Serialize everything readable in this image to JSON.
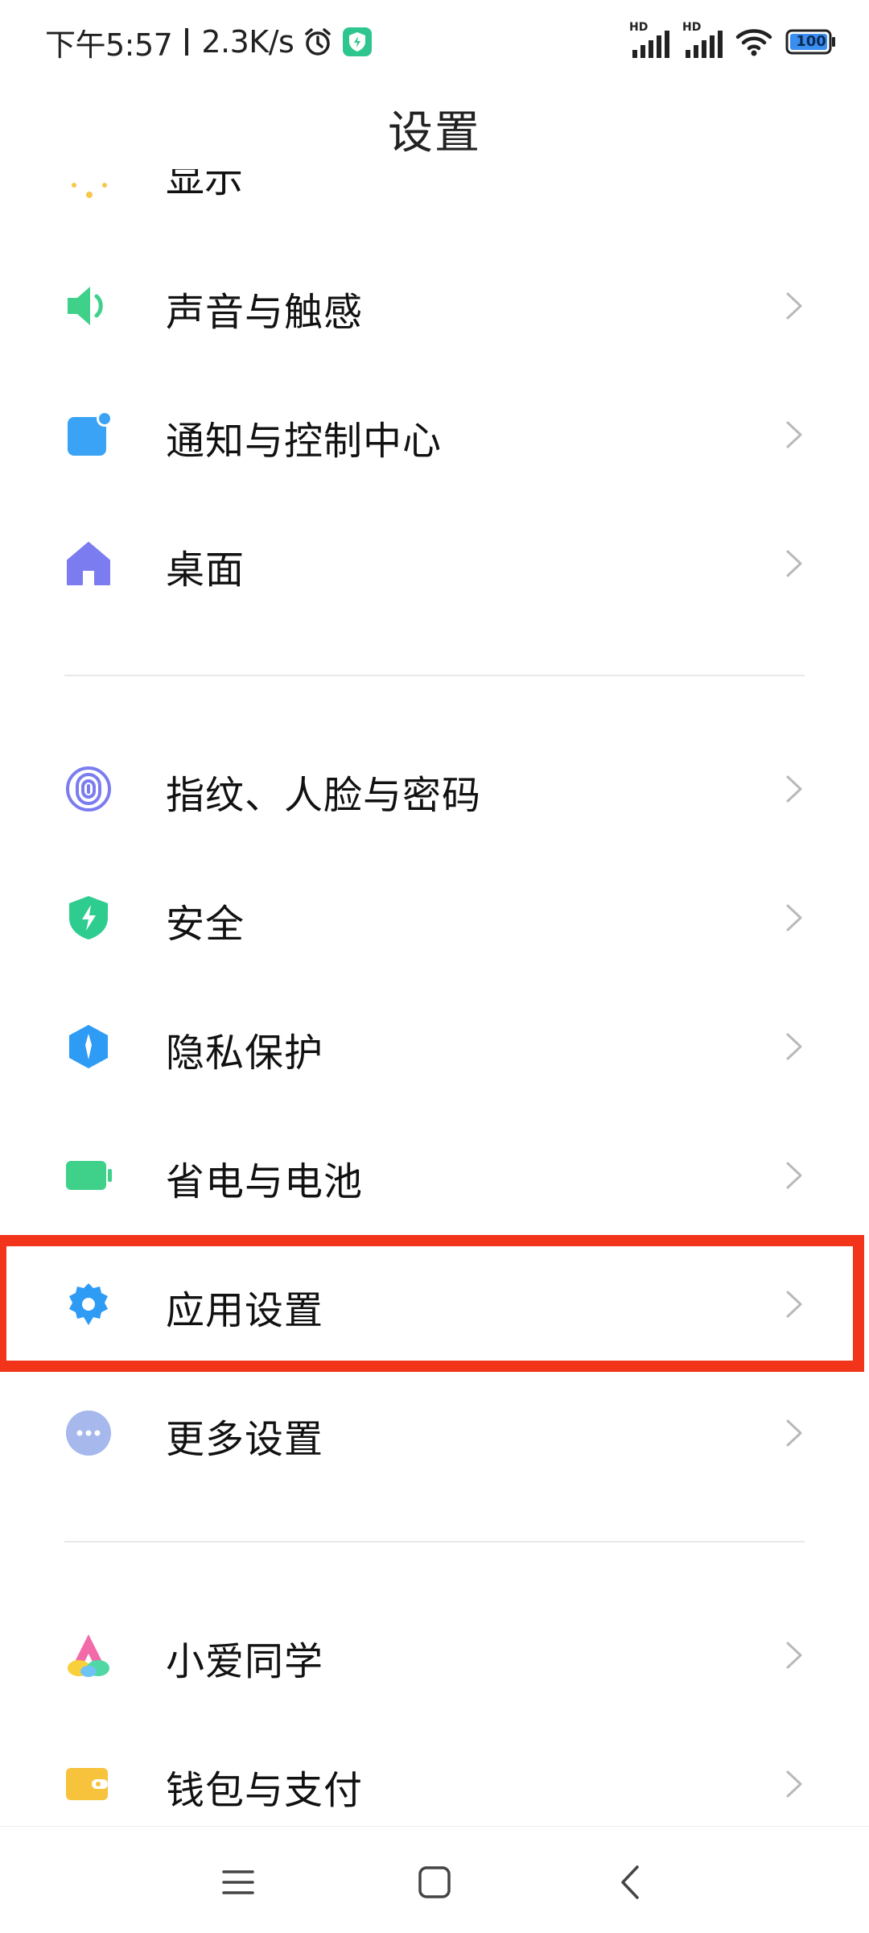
{
  "status_bar": {
    "time": "下午5:57",
    "network_speed": "2.3K/s",
    "signal_1_label": "HD",
    "signal_2_label": "HD",
    "battery_level": "100"
  },
  "header": {
    "title": "设置"
  },
  "partial_item": {
    "label": "显示"
  },
  "sections": [
    {
      "items": [
        {
          "label": "声音与触感",
          "icon": "speaker-icon",
          "color": "#3fd18a"
        },
        {
          "label": "通知与控制中心",
          "icon": "notification-icon",
          "color": "#3aa3f5"
        },
        {
          "label": "桌面",
          "icon": "home-icon",
          "color": "#7b7cf0"
        }
      ]
    },
    {
      "items": [
        {
          "label": "指纹、人脸与密码",
          "icon": "fingerprint-icon",
          "color": "#7b7cf0"
        },
        {
          "label": "安全",
          "icon": "shield-icon",
          "color": "#2ecc8f"
        },
        {
          "label": "隐私保护",
          "icon": "privacy-icon",
          "color": "#2e9bf5"
        },
        {
          "label": "省电与电池",
          "icon": "battery-icon",
          "color": "#3fd18a"
        },
        {
          "label": "应用设置",
          "icon": "gear-icon",
          "color": "#2e9bf5",
          "highlighted": true
        },
        {
          "label": "更多设置",
          "icon": "more-dots-icon",
          "color": "#a6b8ec"
        }
      ]
    },
    {
      "items": [
        {
          "label": "小爱同学",
          "icon": "xiaoai-icon",
          "color": "#f26aa8"
        },
        {
          "label": "钱包与支付",
          "icon": "wallet-icon",
          "color": "#f7c23c"
        }
      ]
    }
  ],
  "highlight_color": "#f1341a",
  "nav_bar": {
    "buttons": [
      "menu-icon",
      "home-square-icon",
      "back-icon"
    ]
  }
}
